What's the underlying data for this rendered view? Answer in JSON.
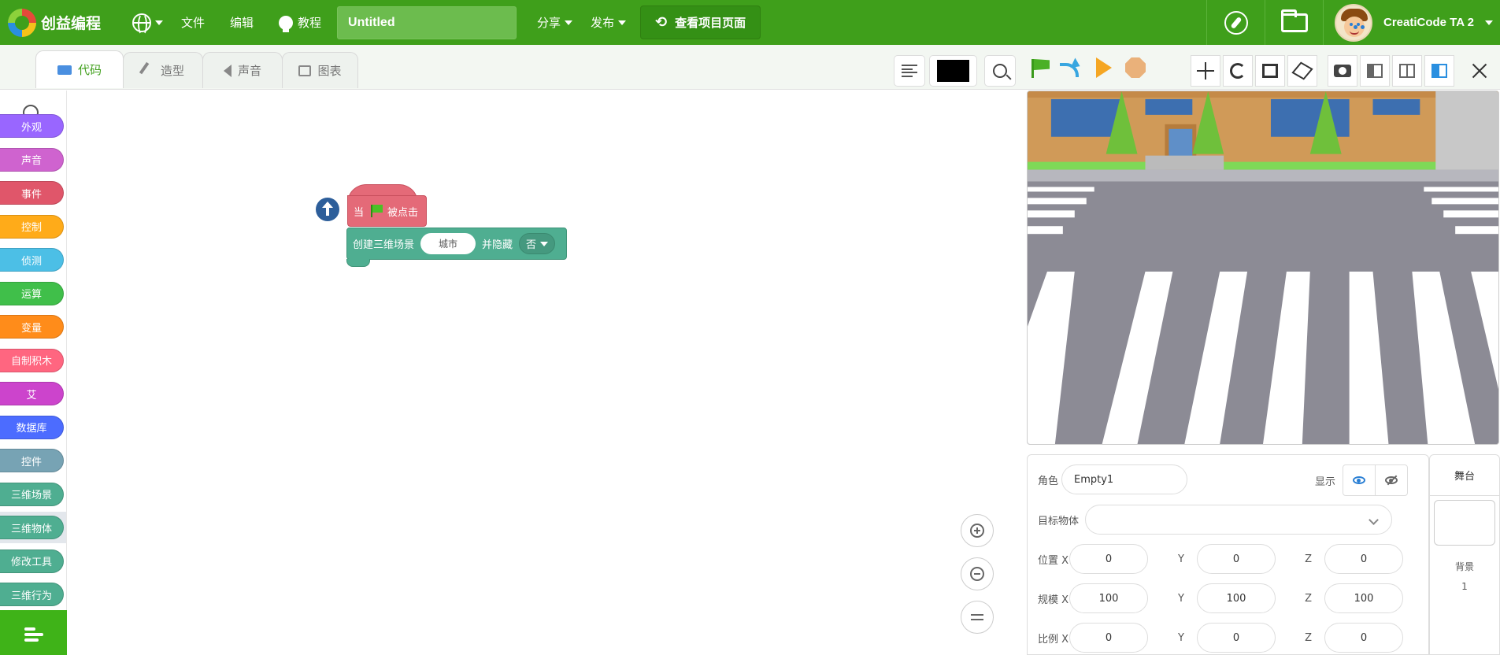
{
  "app": {
    "name": "创益编程",
    "project_title": "Untitled",
    "menu": {
      "file": "文件",
      "edit": "编辑",
      "tutorial": "教程",
      "share": "分享",
      "publish": "发布",
      "view_project": "查看项目页面"
    },
    "user": {
      "name": "CreatiCode TA 2"
    },
    "colors": {
      "menubar": "#3f9f1b",
      "accent": "#3f9f1b"
    }
  },
  "editor_tabs": [
    {
      "label": "代码",
      "icon": "code-icon",
      "active": true
    },
    {
      "label": "造型",
      "icon": "brush-icon",
      "active": false
    },
    {
      "label": "声音",
      "icon": "speaker-icon",
      "active": false
    },
    {
      "label": "图表",
      "icon": "chart-icon",
      "active": false
    }
  ],
  "categories": [
    {
      "label": "外观",
      "color": "#9966ff"
    },
    {
      "label": "声音",
      "color": "#cf63cf"
    },
    {
      "label": "事件",
      "color": "#e0566a"
    },
    {
      "label": "控制",
      "color": "#ffab19"
    },
    {
      "label": "侦测",
      "color": "#4cbfe6"
    },
    {
      "label": "运算",
      "color": "#40bf4a"
    },
    {
      "label": "变量",
      "color": "#ff8c1a"
    },
    {
      "label": "自制积木",
      "color": "#ff6680"
    },
    {
      "label": "艾",
      "color": "#cc44cc"
    },
    {
      "label": "数据库",
      "color": "#4c6cff"
    },
    {
      "label": "控件",
      "color": "#77a3b4"
    },
    {
      "label": "三维场景",
      "color": "#4fae91"
    },
    {
      "label": "三维物体",
      "color": "#4fae91",
      "selected": true
    },
    {
      "label": "修改工具",
      "color": "#4fae91"
    },
    {
      "label": "三维行为",
      "color": "#4fae91"
    }
  ],
  "code": {
    "hat_block": {
      "prefix": "当",
      "suffix": "被点击"
    },
    "command_block": {
      "label": "创建三维场景",
      "scene_value": "城市",
      "hide_label": "并隐藏",
      "hide_value": "否"
    }
  },
  "stage": {
    "colors": {
      "road": "#8c8b95",
      "building": "#c98c4a",
      "sky_building": "#d09a58",
      "tree": "#6fc03b",
      "grass": "#7ed957"
    }
  },
  "sprite_props": {
    "sprite_label": "角色",
    "sprite_name": "Empty1",
    "show_label": "显示",
    "target_label": "目标物体",
    "target_value": "",
    "position": {
      "label": "位置 X",
      "x": "0",
      "y_label": "Y",
      "y": "0",
      "z_label": "Z",
      "z": "0"
    },
    "scale": {
      "label": "规模 X",
      "x": "100",
      "y_label": "Y",
      "y": "100",
      "z_label": "Z",
      "z": "100"
    },
    "ratio": {
      "label": "比例 X",
      "x": "0",
      "y_label": "Y",
      "y": "0",
      "z_label": "Z",
      "z": "0"
    }
  },
  "stage_panel": {
    "title": "舞台",
    "backdrop_label": "背景",
    "backdrop_count": "1"
  }
}
